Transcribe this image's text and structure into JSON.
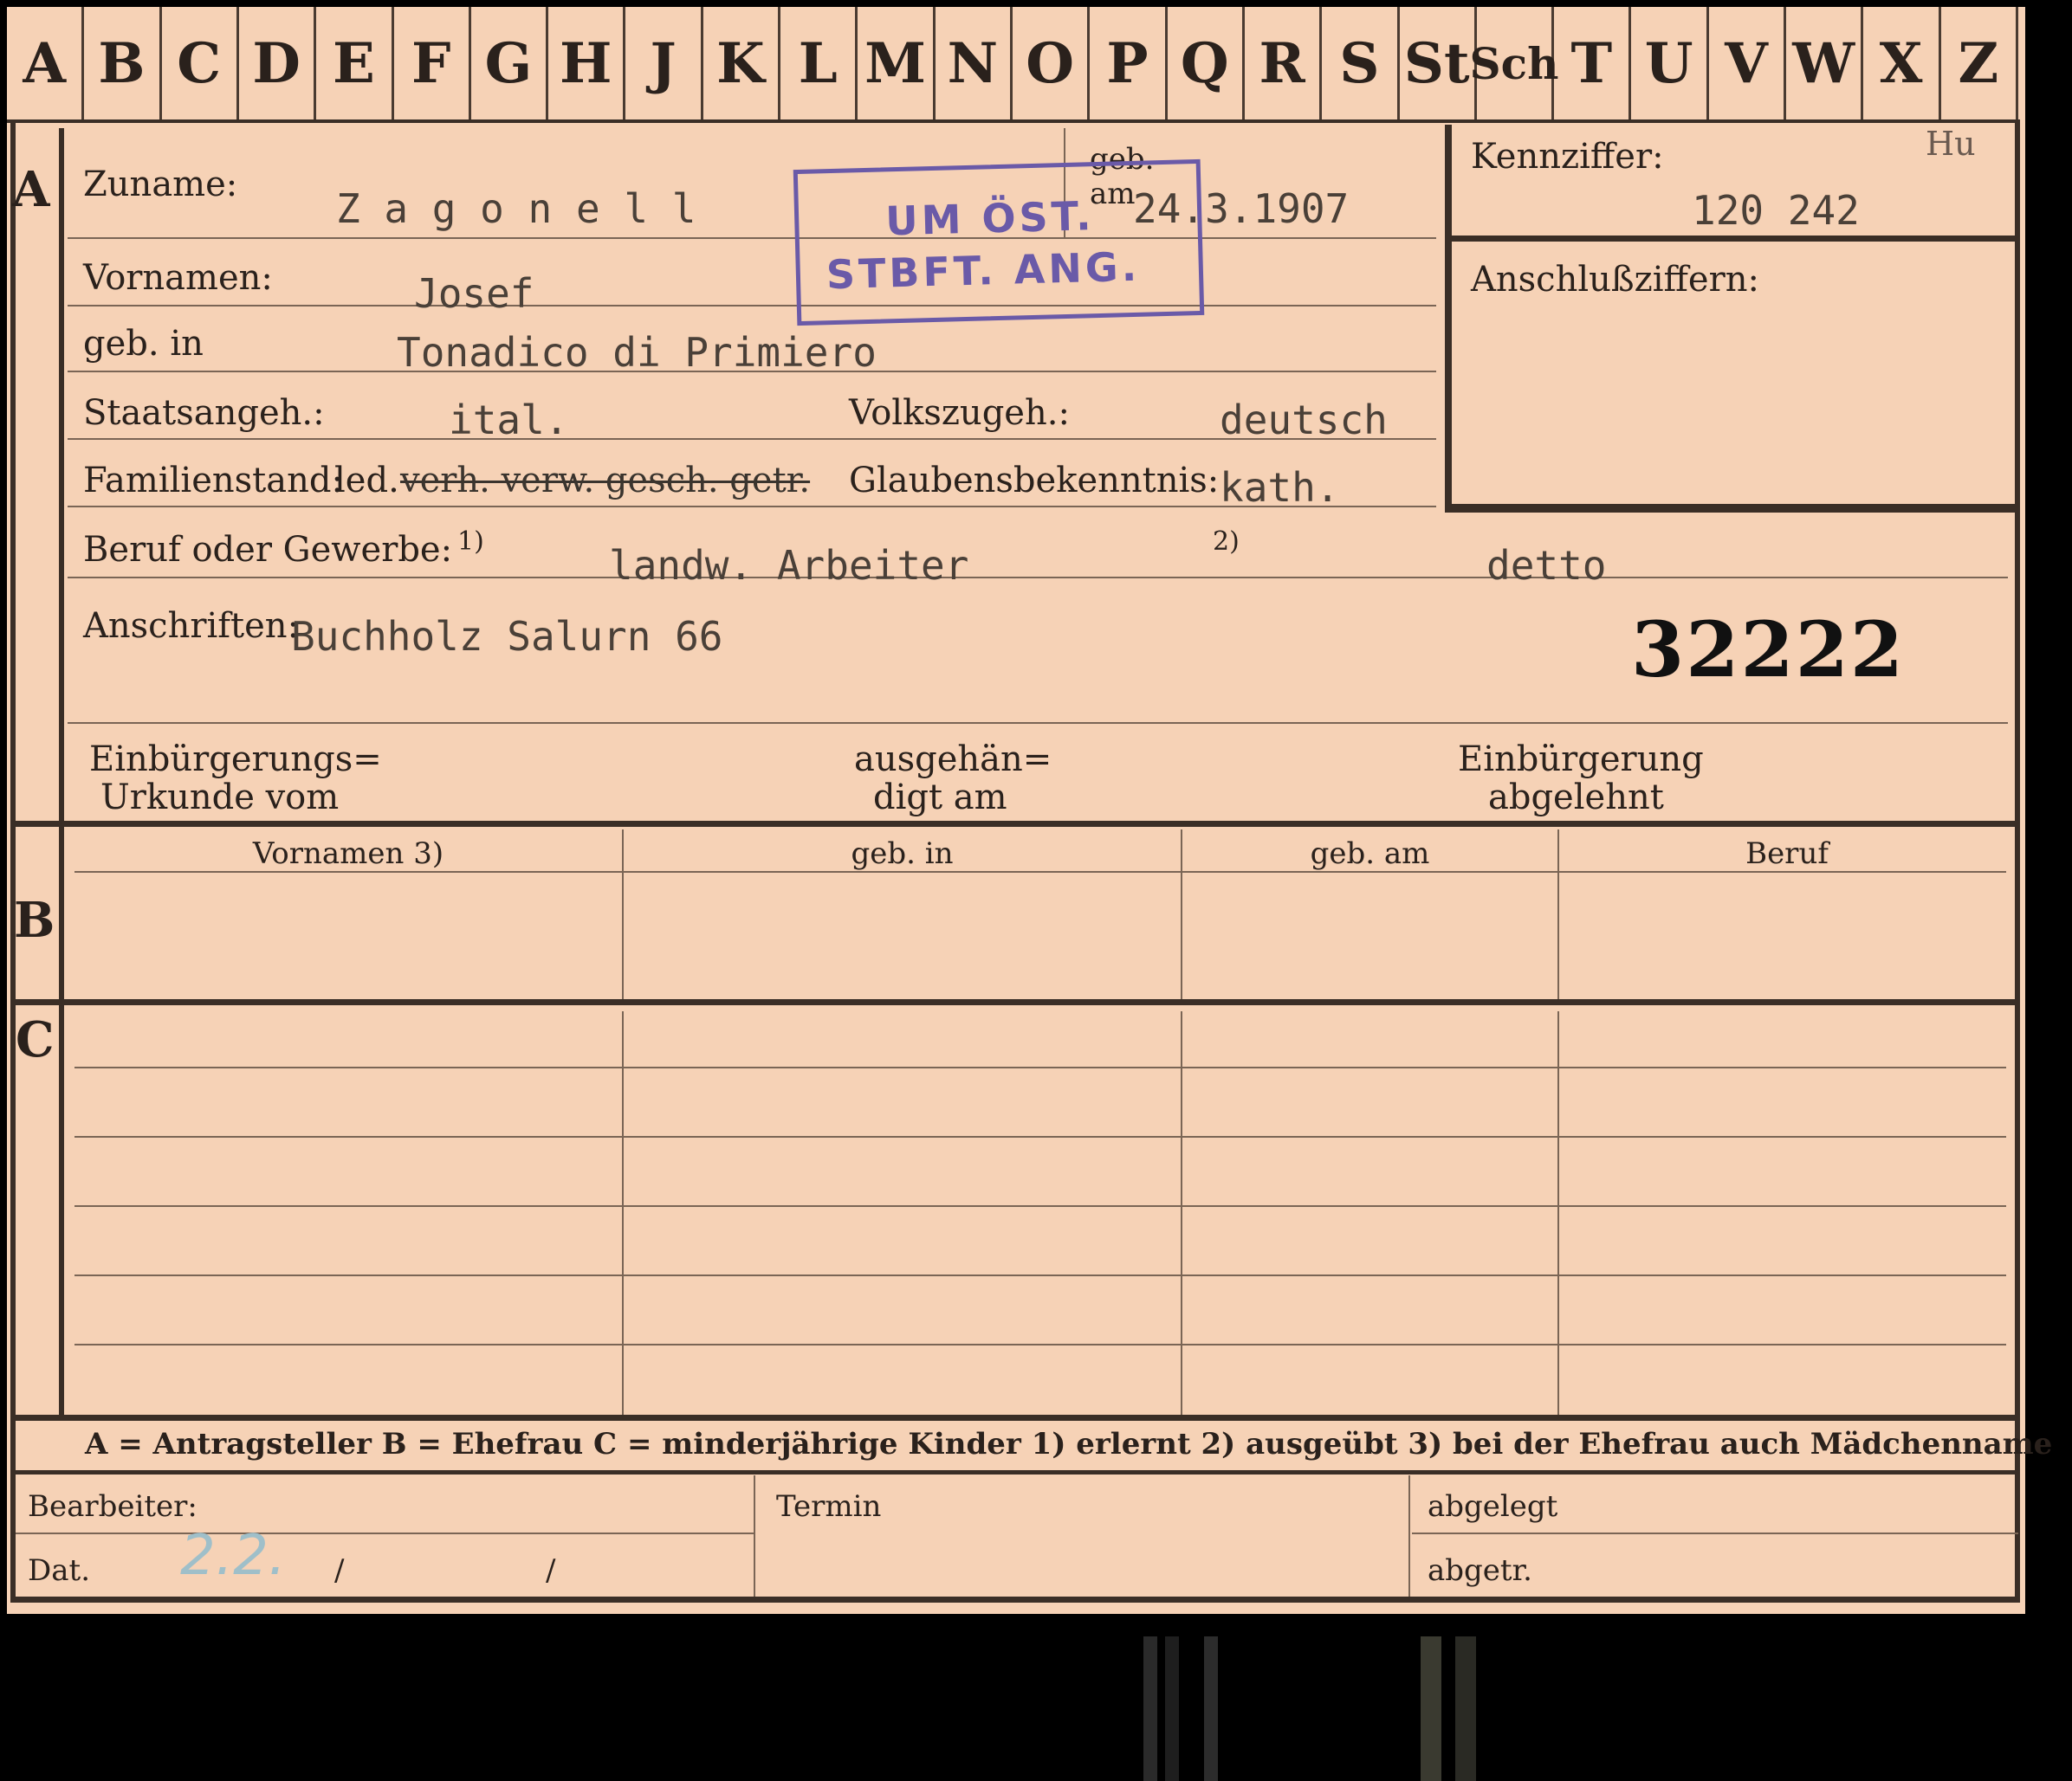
{
  "alphabet": [
    "A",
    "B",
    "C",
    "D",
    "E",
    "F",
    "G",
    "H",
    "J",
    "K",
    "L",
    "M",
    "N",
    "O",
    "P",
    "Q",
    "R",
    "S",
    "St",
    "Sch",
    "T",
    "U",
    "V",
    "W",
    "X",
    "Z"
  ],
  "sections": {
    "a": "A",
    "b": "B",
    "c": "C"
  },
  "fields": {
    "surname_label": "Zuname:",
    "surname_value": "Z a g o n e l l",
    "born_on_label_1": "geb.",
    "born_on_label_2": "am",
    "born_on_value": "24.3.1907",
    "first_names_label": "Vornamen:",
    "first_names_value": "Josef",
    "born_in_label": "geb. in",
    "born_in_value": "Tonadico di Primiero",
    "citizenship_label": "Staatsangeh.:",
    "citizenship_value": "ital.",
    "ethnicity_label": "Volkszugeh.:",
    "ethnicity_value": "deutsch",
    "marital_label": "Familienstand:",
    "marital_single": "led.",
    "marital_struck": "verh. verw. gesch. getr.",
    "religion_label": "Glaubensbekenntnis:",
    "religion_value": "kath.",
    "occupation_label": "Beruf oder Gewerbe:",
    "occupation_note1": "1)",
    "occupation_value": "landw. Arbeiter",
    "occupation_note2": "2)",
    "occupation_value2": "detto",
    "address_label": "Anschriften:",
    "address_value": "Buchholz Salurn 66",
    "record_number": "32222",
    "naturalization_cert_1": "Einbürgerungs=",
    "naturalization_cert_2": "Urkunde vom",
    "handed_out_1": "ausgehän=",
    "handed_out_2": "digt am",
    "naturalization_denied_1": "Einbürgerung",
    "naturalization_denied_2": "abgelehnt"
  },
  "side": {
    "code_label": "Kennziffer:",
    "code_value": "120 242",
    "hu": "Hu",
    "connect_label": "Anschlußziffern:"
  },
  "stamp": {
    "line1": "UM ÖST.",
    "line2": "STBFT. ANG."
  },
  "table_headers": [
    "Vornamen 3)",
    "geb. in",
    "geb. am",
    "Beruf"
  ],
  "legend": "A = Antragsteller   B = Ehefrau   C = minderjährige Kinder   1) erlernt   2) ausgeübt   3) bei der Ehefrau auch Mädchenname",
  "footer": {
    "editor_label": "Bearbeiter:",
    "date_label": "Dat.",
    "date_value": "2.2.",
    "slash1": "/",
    "slash2": "/",
    "deadline_label": "Termin",
    "filed_label": "abgelegt",
    "removed_label": "abgetr."
  }
}
